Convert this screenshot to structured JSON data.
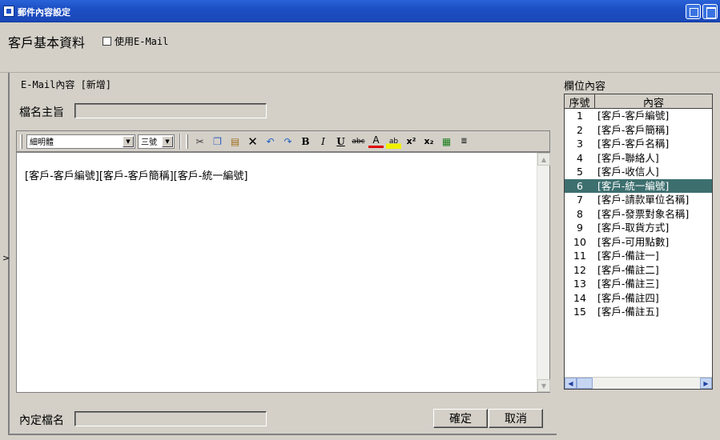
{
  "window": {
    "title": "郵件內容設定"
  },
  "header": {
    "label": "客戶基本資料",
    "use_email_label": "使用E-Mail"
  },
  "left": {
    "section_label": "E-Mail內容 [新增]",
    "subject_label": "檔名主旨",
    "subject_value": "",
    "edge_marker": ">",
    "font_name": "細明體",
    "font_size": "三號",
    "editor_content": "[客戶-客戶編號][客戶-客戶簡稱][客戶-統一編號]",
    "template_label": "內定檔名",
    "template_value": "",
    "confirm_label": "確定",
    "cancel_label": "取消"
  },
  "field_list": {
    "title": "欄位內容",
    "col_no": "序號",
    "col_content": "內容",
    "selected_index": 6,
    "selected_color": "#3d6f6f",
    "rows": [
      {
        "no": "1",
        "content": "[客戶-客戶編號]"
      },
      {
        "no": "2",
        "content": "[客戶-客戶簡稱]"
      },
      {
        "no": "3",
        "content": "[客戶-客戶名稱]"
      },
      {
        "no": "4",
        "content": "[客戶-聯絡人]"
      },
      {
        "no": "5",
        "content": "[客戶-收信人]"
      },
      {
        "no": "6",
        "content": "[客戶-統一編號]"
      },
      {
        "no": "7",
        "content": "[客戶-請款單位名稱]"
      },
      {
        "no": "8",
        "content": "[客戶-發票對象名稱]"
      },
      {
        "no": "9",
        "content": "[客戶-取貨方式]"
      },
      {
        "no": "10",
        "content": "[客戶-可用點數]"
      },
      {
        "no": "11",
        "content": "[客戶-備註一]"
      },
      {
        "no": "12",
        "content": "[客戶-備註二]"
      },
      {
        "no": "13",
        "content": "[客戶-備註三]"
      },
      {
        "no": "14",
        "content": "[客戶-備註四]"
      },
      {
        "no": "15",
        "content": "[客戶-備註五]"
      }
    ]
  },
  "toolbar_icons": [
    "cut-icon",
    "copy-icon",
    "paste-icon",
    "delete-icon",
    "undo-icon",
    "redo-icon",
    "bold-icon",
    "italic-icon",
    "underline-icon",
    "strikethrough-icon",
    "font-color-icon",
    "highlight-icon",
    "superscript-icon",
    "subscript-icon",
    "table-icon",
    "line-icon"
  ]
}
